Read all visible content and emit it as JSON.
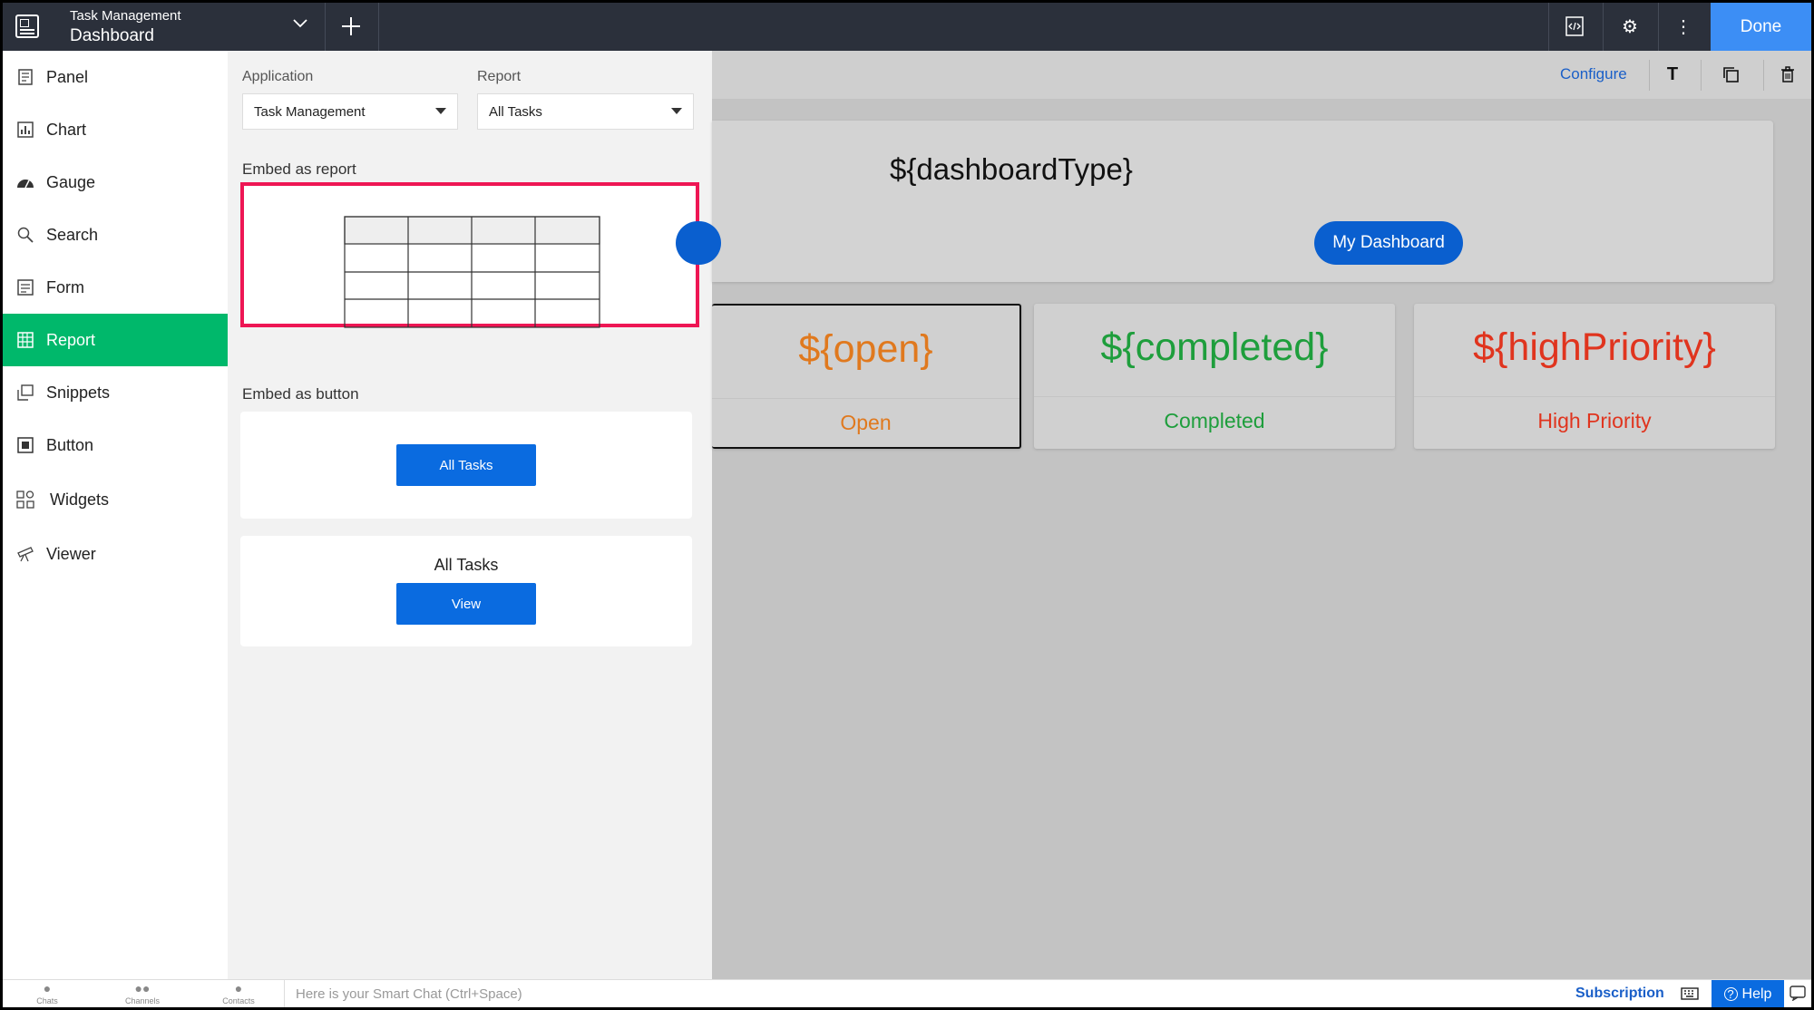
{
  "topbar": {
    "app_name": "Task Management",
    "page_name": "Dashboard",
    "done_label": "Done",
    "icons": [
      "app-icon",
      "chevron-down-icon",
      "plus-icon",
      "code-icon",
      "gear-icon",
      "more-vertical-icon"
    ]
  },
  "sidebar": {
    "items": [
      {
        "label": "Panel",
        "icon": "panel-icon"
      },
      {
        "label": "Chart",
        "icon": "chart-icon"
      },
      {
        "label": "Gauge",
        "icon": "gauge-icon"
      },
      {
        "label": "Search",
        "icon": "search-icon"
      },
      {
        "label": "Form",
        "icon": "form-icon"
      },
      {
        "label": "Report",
        "icon": "report-grid-icon",
        "active": true
      },
      {
        "label": "Snippets",
        "icon": "snippets-icon"
      },
      {
        "label": "Button",
        "icon": "button-icon"
      },
      {
        "label": "Widgets",
        "icon": "widgets-icon"
      },
      {
        "label": "Viewer",
        "icon": "viewer-icon"
      }
    ],
    "active_color": "#00b86b"
  },
  "panel": {
    "application_label": "Application",
    "application_value": "Task Management",
    "report_label": "Report",
    "report_value": "All Tasks",
    "embed_report_label": "Embed as report",
    "embed_button_label": "Embed as button",
    "button_card": {
      "button_label": "All Tasks"
    },
    "view_card": {
      "title": "All Tasks",
      "button_label": "View"
    },
    "highlight_color": "#ee1654"
  },
  "canvas": {
    "configure_label": "Configure",
    "text_tool": "T",
    "dashboard_type": "${dashboardType}",
    "my_dashboard_label": "My Dashboard",
    "stats": [
      {
        "value": "${open}",
        "label": "Open",
        "color": "#e0791e"
      },
      {
        "value": "${completed}",
        "label": "Completed",
        "color": "#1e9e3c"
      },
      {
        "value": "${highPriority}",
        "label": "High Priority",
        "color": "#e0341e"
      }
    ]
  },
  "bottombar": {
    "tabs": [
      "Chats",
      "Channels",
      "Contacts"
    ],
    "smart_chat_placeholder": "Here is your Smart Chat (Ctrl+Space)",
    "subscription_label": "Subscription",
    "help_label": "Help"
  }
}
